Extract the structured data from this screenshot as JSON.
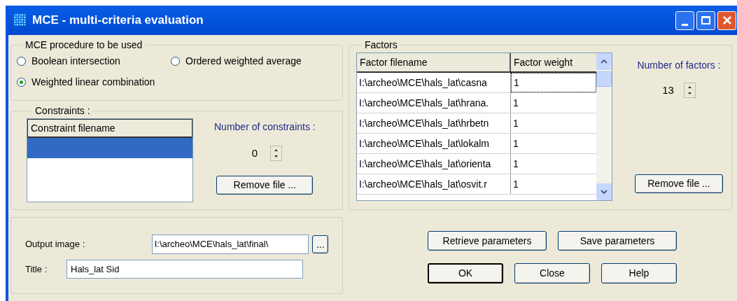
{
  "window": {
    "title": "MCE - multi-criteria evaluation"
  },
  "procedure": {
    "label": "MCE procedure to be used",
    "options": [
      {
        "label": "Boolean intersection",
        "selected": false
      },
      {
        "label": "Ordered weighted average",
        "selected": false
      },
      {
        "label": "Weighted linear combination",
        "selected": true
      }
    ]
  },
  "constraints": {
    "label": "Constraints :",
    "column": "Constraint filename",
    "rows": [
      {
        "selected": true
      }
    ],
    "count_label": "Number of constraints :",
    "count": "0",
    "remove_button": "Remove file ..."
  },
  "factors": {
    "label": "Factors",
    "columns": [
      "Factor filename",
      "Factor weight"
    ],
    "rows": [
      {
        "filename": "I:\\archeo\\MCE\\hals_lat\\casna",
        "weight": "1",
        "focused": true
      },
      {
        "filename": "I:\\archeo\\MCE\\hals_lat\\hrana.",
        "weight": "1",
        "focused": false
      },
      {
        "filename": "I:\\archeo\\MCE\\hals_lat\\hrbetn",
        "weight": "1",
        "focused": false
      },
      {
        "filename": "I:\\archeo\\MCE\\hals_lat\\lokalm",
        "weight": "1",
        "focused": false
      },
      {
        "filename": "I:\\archeo\\MCE\\hals_lat\\orienta",
        "weight": "1",
        "focused": false
      },
      {
        "filename": "I:\\archeo\\MCE\\hals_lat\\osvit.r",
        "weight": "1",
        "focused": false
      }
    ],
    "count_label": "Number of factors :",
    "count": "13",
    "remove_button": "Remove file ..."
  },
  "output": {
    "image_label": "Output image :",
    "image_value": "I:\\archeo\\MCE\\hals_lat\\final\\",
    "browse_button": "...",
    "title_label": "Title :",
    "title_value": "Hals_lat Sid"
  },
  "parameter_buttons": [
    "Retrieve parameters",
    "Save parameters"
  ],
  "dialog_buttons": [
    {
      "label": "OK",
      "default": true
    },
    {
      "label": "Close",
      "default": false
    },
    {
      "label": "Help",
      "default": false
    }
  ]
}
